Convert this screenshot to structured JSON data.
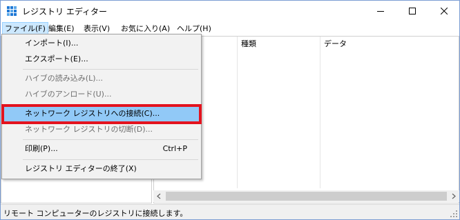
{
  "window": {
    "title": "レジストリ エディター",
    "icon": "registry-editor-icon",
    "controls": [
      "minimize-icon",
      "maximize-icon",
      "close-icon"
    ]
  },
  "menubar": {
    "items": [
      {
        "label": "ファイル(F)"
      },
      {
        "label": "編集(E)"
      },
      {
        "label": "表示(V)"
      },
      {
        "label": "お気に入り(A)"
      },
      {
        "label": "ヘルプ(H)"
      }
    ]
  },
  "list": {
    "columns": [
      "種類",
      "データ"
    ]
  },
  "file_menu": {
    "items": [
      {
        "label": "インポート(I)...",
        "enabled": true
      },
      {
        "label": "エクスポート(E)...",
        "enabled": true
      },
      {
        "label": "ハイブの読み込み(L)...",
        "enabled": false
      },
      {
        "label": "ハイブのアンロード(U)...",
        "enabled": false
      },
      {
        "label": "ネットワーク レジストリへの接続(C)...",
        "enabled": true,
        "highlighted": true
      },
      {
        "label": "ネットワーク レジストリの切断(D)...",
        "enabled": false
      },
      {
        "label": "印刷(P)...",
        "enabled": true,
        "shortcut": "Ctrl+P"
      },
      {
        "label": "レジストリ エディターの終了(X)",
        "enabled": true
      }
    ]
  },
  "status": {
    "text": "リモート コンピューターのレジストリに接続します。"
  },
  "colors": {
    "highlight_border": "#e3131e",
    "hover_bg": "#91c9f7",
    "active_menu_bg": "#cce8ff"
  }
}
